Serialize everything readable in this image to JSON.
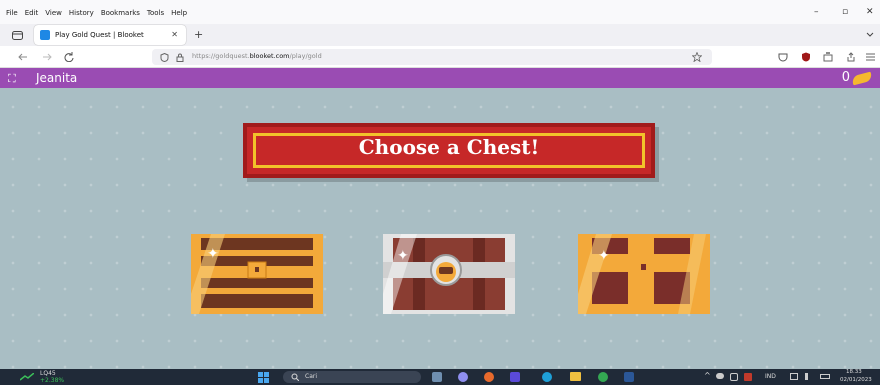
{
  "menubar": {
    "items": [
      "File",
      "Edit",
      "View",
      "History",
      "Bookmarks",
      "Tools",
      "Help"
    ],
    "minimize": "–",
    "restore": "▫",
    "close": "✕"
  },
  "tab": {
    "title": "Play Gold Quest | Blooket",
    "close": "✕",
    "new_tab": "+"
  },
  "navbar": {
    "url_prefix": "https://goldquest.",
    "url_domain": "blooket.com",
    "url_path": "/play/gold"
  },
  "game": {
    "player_name": "Jeanita",
    "gold": "0",
    "banner": "Choose a Chest!",
    "chests": [
      "chest-1",
      "chest-2",
      "chest-3"
    ]
  },
  "taskbar": {
    "weather_label": "LQ45",
    "weather_value": "+2.38%",
    "search": "Cari",
    "lang": "IND",
    "time": "18.33",
    "date": "02/01/2023"
  },
  "colors": {
    "purple_bar": "#9a4cb3",
    "background": "#a9bec4",
    "banner_red": "#c62828",
    "gold": "#f5b82e"
  }
}
